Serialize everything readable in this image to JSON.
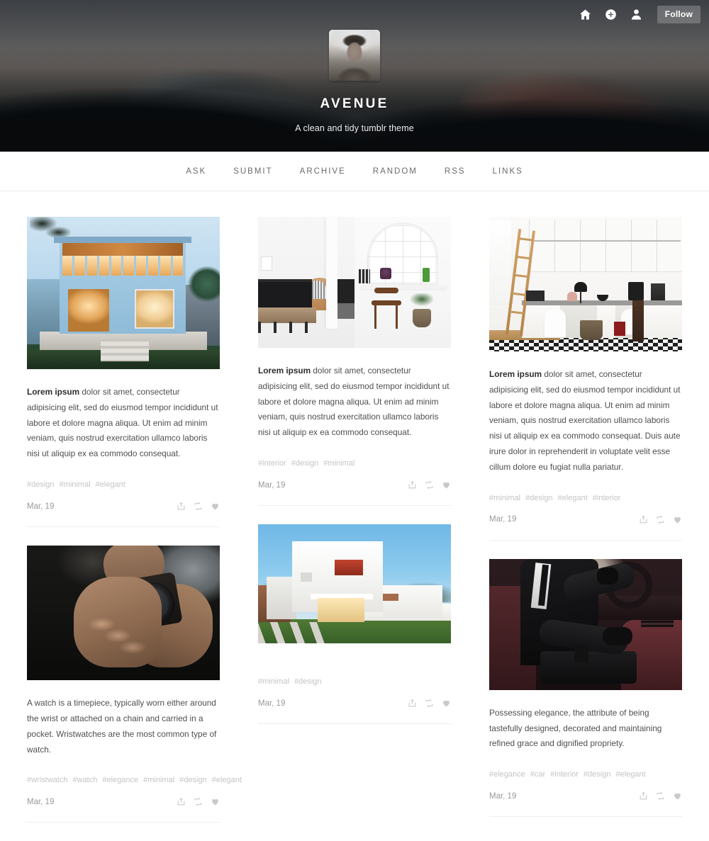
{
  "header": {
    "blog_title": "AVENUE",
    "blog_description": "A clean and tidy tumblr theme",
    "avatar_alt": "avatar",
    "controls": {
      "home_icon": "home-icon",
      "add_icon": "add-post-icon",
      "account_icon": "account-icon",
      "follow_label": "Follow"
    }
  },
  "nav": {
    "items": [
      {
        "label": "ASK"
      },
      {
        "label": "SUBMIT"
      },
      {
        "label": "ARCHIVE"
      },
      {
        "label": "RANDOM"
      },
      {
        "label": "RSS"
      },
      {
        "label": "LINKS"
      }
    ]
  },
  "actions": {
    "share_icon": "share-icon",
    "reblog_icon": "reblog-icon",
    "like_icon": "heart-icon"
  },
  "columns": [
    {
      "posts": [
        {
          "image": "blue-modern-house-at-dusk",
          "lead": "Lorem ipsum",
          "text": " dolor sit amet, consectetur adipisicing elit, sed do eiusmod tempor incididunt ut labore et dolore magna aliqua. Ut enim ad minim veniam, quis nostrud exercitation ullamco laboris nisi ut aliquip ex ea commodo consequat.",
          "tags": [
            "#design",
            "#minimal",
            "#elegant"
          ],
          "date": "Mar, 19"
        },
        {
          "image": "black-watch-held-in-hand",
          "lead": "",
          "text": "A watch is a timepiece, typically worn either around the wrist or attached on a chain and carried in a pocket. Wristwatches are the most common type of watch.",
          "tags": [
            "#wristwatch",
            "#watch",
            "#elegance",
            "#minimal",
            "#design",
            "#elegant"
          ],
          "date": "Mar, 19"
        }
      ]
    },
    {
      "posts": [
        {
          "image": "white-interior-diptych",
          "lead": "Lorem ipsum",
          "text": " dolor sit amet, consectetur adipisicing elit, sed do eiusmod tempor incididunt ut labore et dolore magna aliqua. Ut enim ad minim veniam, quis nostrud exercitation ullamco laboris nisi ut aliquip ex ea commodo consequat.",
          "tags": [
            "#interior",
            "#design",
            "#minimal"
          ],
          "date": "Mar, 19"
        },
        {
          "image": "modern-white-house-at-dusk",
          "lead": "",
          "text": "",
          "tags": [
            "#minimal",
            "#design"
          ],
          "date": "Mar, 19"
        }
      ]
    },
    {
      "posts": [
        {
          "image": "white-kitchen-with-ladder",
          "lead": "Lorem ipsum",
          "text": " dolor sit amet, consectetur adipisicing elit, sed do eiusmod tempor incididunt ut labore et dolore magna aliqua. Ut enim ad minim veniam, quis nostrud exercitation ullamco laboris nisi ut aliquip ex ea commodo consequat. Duis aute irure dolor in reprehenderit in voluptate velit esse cillum dolore eu fugiat nulla pariatur.",
          "tags": [
            "#minimal",
            "#design",
            "#elegant",
            "#interior"
          ],
          "date": "Mar, 19"
        },
        {
          "image": "man-in-suit-driving-car",
          "lead": "",
          "text": "Possessing elegance, the attribute of being tastefully designed, decorated and maintaining refined grace and dignified propriety.",
          "tags": [
            "#elegance",
            "#car",
            "#interior",
            "#design",
            "#elegant"
          ],
          "date": "Mar, 19"
        }
      ]
    }
  ],
  "colors": {
    "header_overlay": "#3a3f44",
    "follow_button_bg": "rgba(255,255,255,0.22)",
    "nav_text": "#6a6a6a",
    "body_text": "#4f4f4f",
    "tag_text": "#c4c4c4",
    "date_text": "#9a9a9a"
  }
}
